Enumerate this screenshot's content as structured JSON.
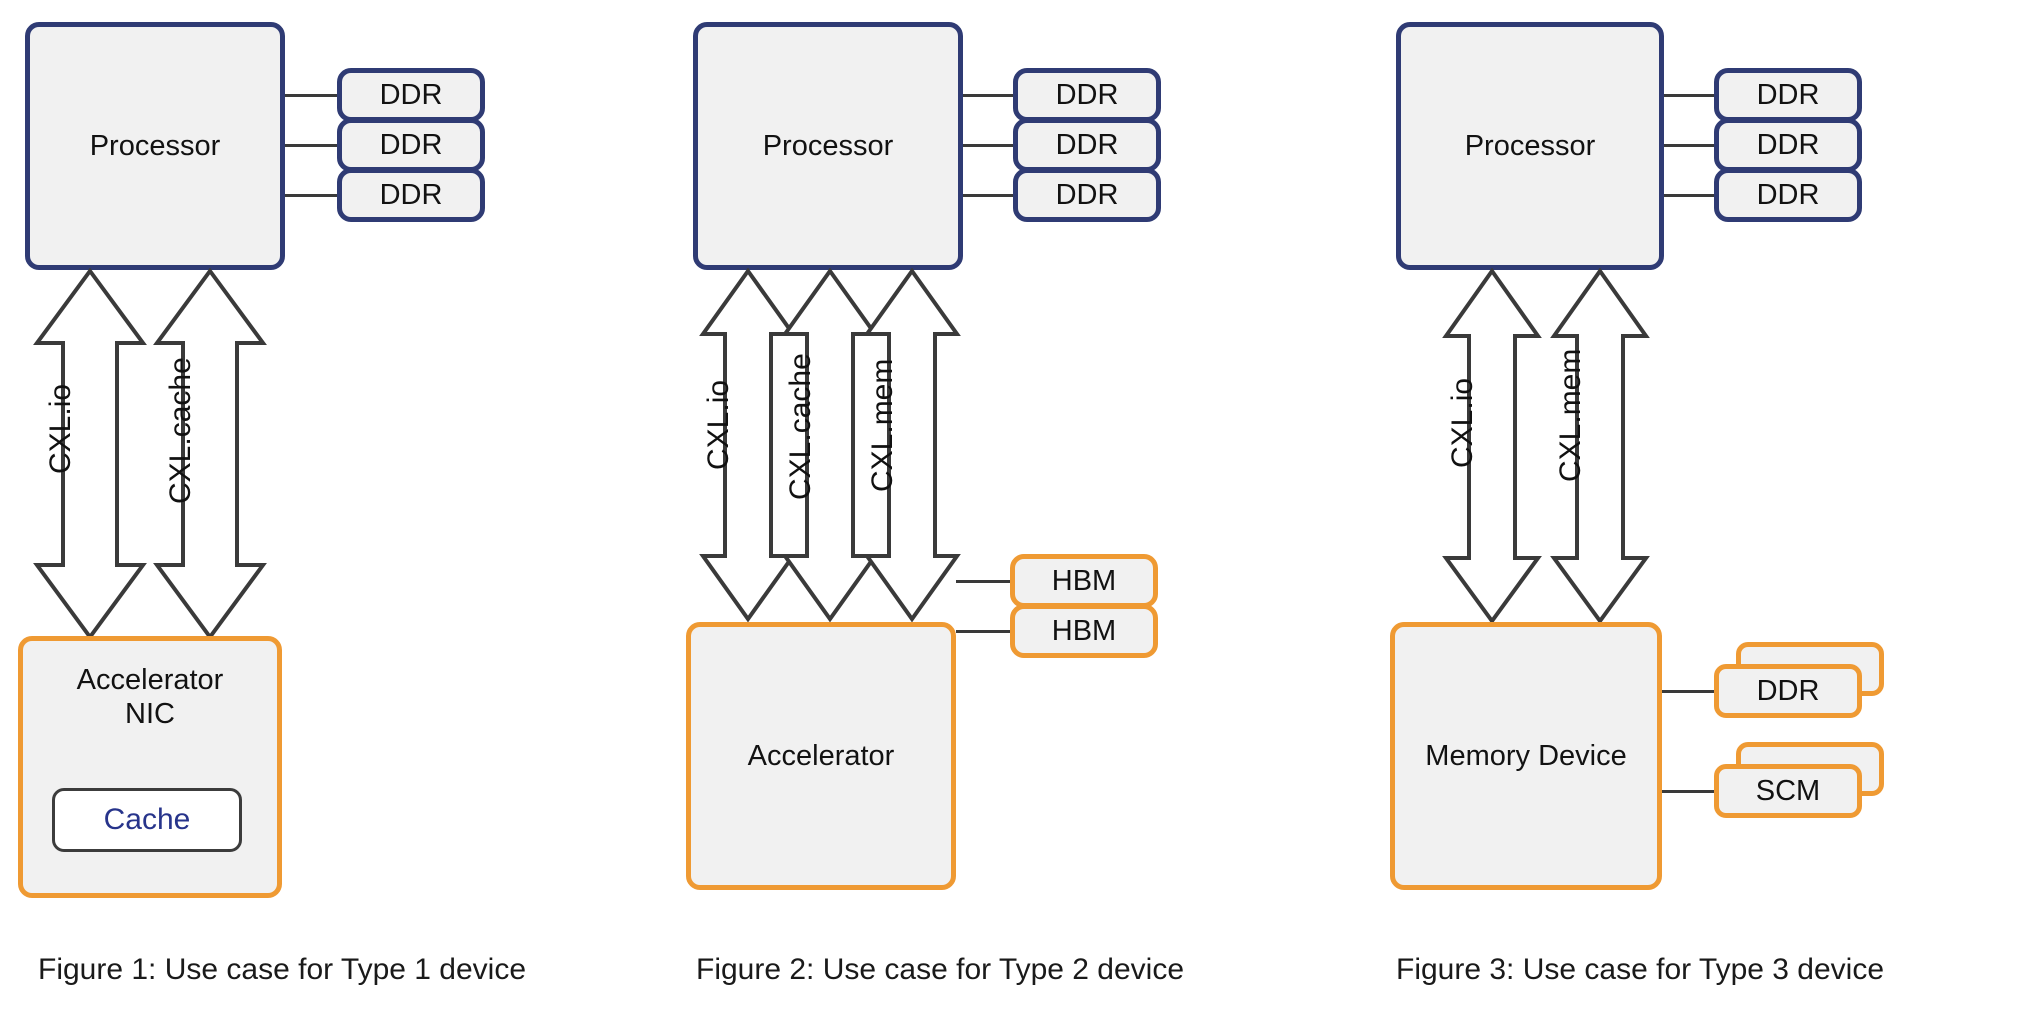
{
  "diagram": {
    "title": "CXL device type use cases",
    "colors": {
      "processor_border": "#2f3b74",
      "device_border": "#ef9a33",
      "box_fill": "#f1f1f1",
      "cache_text": "#27348b",
      "arrow_stroke": "#3a3a3a",
      "connector": "#3a3a3a"
    }
  },
  "panels": [
    {
      "id": "type-1",
      "host": {
        "label": "Processor"
      },
      "host_memories": [
        {
          "label": "DDR"
        },
        {
          "label": "DDR"
        },
        {
          "label": "DDR"
        }
      ],
      "links": [
        {
          "label": "CXL.io"
        },
        {
          "label": "CXL.cache"
        }
      ],
      "device": {
        "line1": "Accelerator",
        "line2": "NIC",
        "inner": {
          "label": "Cache"
        }
      },
      "device_memories": [],
      "caption": "Figure 1: Use case for Type 1 device"
    },
    {
      "id": "type-2",
      "host": {
        "label": "Processor"
      },
      "host_memories": [
        {
          "label": "DDR"
        },
        {
          "label": "DDR"
        },
        {
          "label": "DDR"
        }
      ],
      "links": [
        {
          "label": "CXL.io"
        },
        {
          "label": "CXL.cache"
        },
        {
          "label": "CXL.mem"
        }
      ],
      "device": {
        "line1": "Accelerator",
        "line2": "",
        "inner": null
      },
      "device_memories": [
        {
          "label": "HBM",
          "stacked": false
        },
        {
          "label": "HBM",
          "stacked": false
        }
      ],
      "caption": "Figure 2: Use case for Type 2 device"
    },
    {
      "id": "type-3",
      "host": {
        "label": "Processor"
      },
      "host_memories": [
        {
          "label": "DDR"
        },
        {
          "label": "DDR"
        },
        {
          "label": "DDR"
        }
      ],
      "links": [
        {
          "label": "CXL.io"
        },
        {
          "label": "CXL.mem"
        }
      ],
      "device": {
        "line1": "Memory Device",
        "line2": "",
        "inner": null
      },
      "device_memories": [
        {
          "label": "DDR",
          "stacked": true
        },
        {
          "label": "SCM",
          "stacked": true
        }
      ],
      "caption": "Figure 3: Use case for Type 3 device"
    }
  ]
}
